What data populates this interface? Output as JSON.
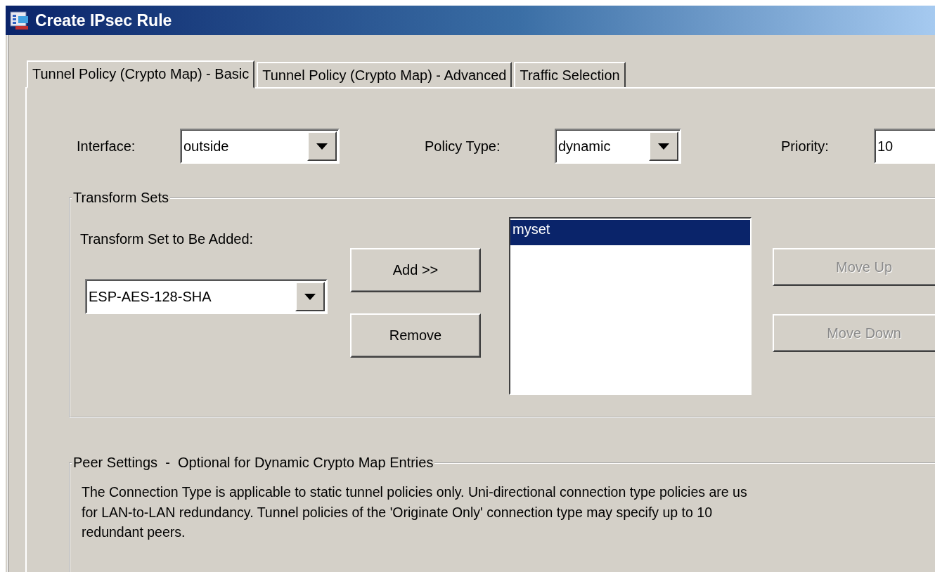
{
  "window": {
    "title": "Create IPsec Rule"
  },
  "tabs": [
    {
      "label": "Tunnel Policy (Crypto Map) - Basic",
      "selected": true
    },
    {
      "label": "Tunnel Policy (Crypto Map) - Advanced",
      "selected": false
    },
    {
      "label": "Traffic Selection",
      "selected": false
    }
  ],
  "fields": [
    {
      "label": "Interface:",
      "value": "outside",
      "kind": "combo"
    },
    {
      "label": "Policy Type:",
      "value": "dynamic",
      "kind": "combo"
    },
    {
      "label": "Priority:",
      "value": "10",
      "kind": "text"
    }
  ],
  "transform_sets": {
    "title": "Transform Sets",
    "add_label": "Transform Set to Be Added:",
    "add_value": "ESP-AES-128-SHA",
    "buttons": [
      {
        "label": "Add >>",
        "disabled": false
      },
      {
        "label": "Remove",
        "disabled": false
      }
    ],
    "list": [
      {
        "label": "myset",
        "selected": true
      }
    ],
    "move_buttons": [
      {
        "label": "Move Up",
        "disabled": true
      },
      {
        "label": "Move Down",
        "disabled": true
      }
    ]
  },
  "peer_settings": {
    "title": "Peer Settings  -  Optional for Dynamic Crypto Map Entries",
    "text": "The Connection Type is applicable to static tunnel policies only. Uni-directional connection type policies are us\nfor LAN-to-LAN redundancy. Tunnel policies of the 'Originate Only' connection type may specify up to 10\nredundant peers."
  }
}
